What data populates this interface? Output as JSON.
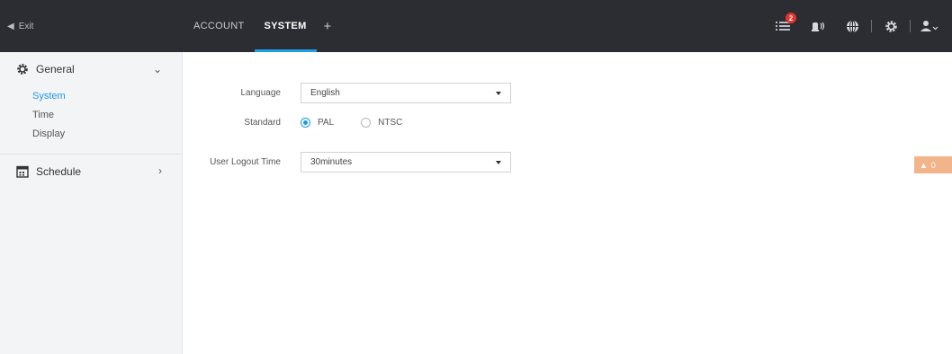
{
  "topbar": {
    "exit_label": "Exit",
    "tabs": [
      {
        "label": "ACCOUNT",
        "active": false
      },
      {
        "label": "SYSTEM",
        "active": true
      }
    ],
    "add_tab_label": "+",
    "notification_count": "2"
  },
  "sidebar": {
    "groups": [
      {
        "label": "General",
        "icon": "gear-icon",
        "expanded": true,
        "items": [
          "System",
          "Time",
          "Display"
        ],
        "active_item": "System"
      },
      {
        "label": "Schedule",
        "icon": "calendar-icon",
        "expanded": false
      }
    ]
  },
  "form": {
    "language": {
      "label": "Language",
      "value": "English"
    },
    "standard": {
      "label": "Standard",
      "options": [
        "PAL",
        "NTSC"
      ],
      "selected": "PAL"
    },
    "logout": {
      "label": "User Logout Time",
      "value": "30minutes"
    }
  },
  "alarm": {
    "count": "0"
  },
  "colors": {
    "topbar": "#2b2d33",
    "accent": "#1a9bdf",
    "badge": "#e6332a",
    "alarm": "#f2b48a"
  }
}
